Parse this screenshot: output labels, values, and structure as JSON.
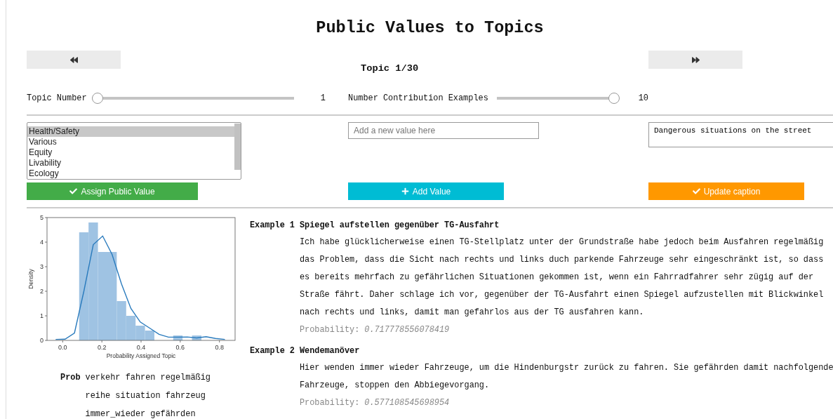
{
  "title": "Public Values to Topics",
  "nav": {
    "topic_label": "Topic 1/30"
  },
  "sliders": [
    {
      "label": "Topic Number",
      "level": 0,
      "reading": "1"
    },
    {
      "label": "Number Contribution Examples",
      "level": 1,
      "reading": "10"
    }
  ],
  "values_list": {
    "items": [
      {
        "label": "Health/Safety",
        "selected": true
      },
      {
        "label": "Various",
        "selected": false
      },
      {
        "label": "Equity",
        "selected": false
      },
      {
        "label": "Livability",
        "selected": false
      },
      {
        "label": "Ecology",
        "selected": false
      }
    ]
  },
  "new_value": {
    "placeholder": "Add a new value here"
  },
  "caption": {
    "value": "Dangerous situations on the street"
  },
  "buttons": [
    {
      "kind": "assign",
      "label": "Assign Public Value",
      "color": "#43ac48"
    },
    {
      "kind": "add",
      "label": "Add Value",
      "color": "#00bcd4"
    },
    {
      "kind": "update",
      "label": "Update caption",
      "color": "#ff9800"
    }
  ],
  "chart": {
    "chart_data": {
      "type": "bar",
      "xlabel": "Probability Assigned Topic",
      "ylabel": "Density",
      "x": [
        -0.036,
        0.012,
        0.06,
        0.108,
        0.156,
        0.204,
        0.252,
        0.3,
        0.348,
        0.396,
        0.444,
        0.492,
        0.54,
        0.588,
        0.636,
        0.684,
        0.732,
        0.78,
        0.828
      ],
      "series": [
        {
          "type": "bar",
          "color": "#9fc3e3",
          "values": [
            null,
            null,
            null,
            4.4,
            4.8,
            3.6,
            3.6,
            1.6,
            1.0,
            0.6,
            0.4,
            null,
            null,
            0.2,
            null,
            0.2,
            null,
            null,
            null
          ]
        },
        {
          "type": "line",
          "color": "#2a7bbd",
          "values": [
            0.04,
            0.05,
            0.3,
            2.0,
            3.9,
            4.25,
            3.5,
            2.3,
            1.3,
            0.75,
            0.5,
            0.25,
            0.13,
            0.13,
            0.14,
            0.1,
            0.15,
            0.08,
            0.04
          ]
        }
      ],
      "xlim": [
        -0.08,
        0.88
      ],
      "ylim": [
        0,
        5
      ],
      "xticks": [
        {
          "value": 0,
          "label": "0.0"
        },
        {
          "value": 0.2,
          "label": "0.2"
        },
        {
          "value": 0.4,
          "label": "0.4"
        },
        {
          "value": 0.6,
          "label": "0.6"
        },
        {
          "value": 0.8,
          "label": "0.8"
        }
      ],
      "yticks": [
        0,
        1,
        2,
        3,
        4,
        5
      ]
    }
  },
  "prob_words": {
    "label": "Prob",
    "lines": [
      "verkehr fahren regelmäßig",
      "reihe situation fahrzeug",
      "immer_wieder gefährden"
    ]
  },
  "examples": [
    {
      "label": "Example 1",
      "title": "Spiegel aufstellen gegenüber TG-Ausfahrt",
      "text": "Ich habe glücklicherweise einen TG-Stellplatz unter der Grundstraße habe jedoch beim Ausfahren regelmäßig das Problem, dass die Sicht nach rechts und links duch parkende Fahrzeuge sehr eingeschränkt ist, so dass es bereits mehrfach zu gefährlichen Situationen gekommen ist, wenn ein Fahrradfahrer sehr zügig auf der Straße fährt. Daher schlage ich vor, gegenüber der TG-Ausfahrt einen Spiegel aufzustellen mit Blickwinkel nach rechts und links, damit man gefahrlos aus der TG ausfahren kann.",
      "prob_label": "Probability:",
      "prob_value": "0.717778556078419"
    },
    {
      "label": "Example 2",
      "title": "Wendemanöver",
      "text": "Hier wenden immer wieder Fahrzeuge, um die Hindenburgstr zurück zu fahren. Sie gefährden damit nachfolgende Fahrzeuge, stoppen den Abbiegevorgang.",
      "prob_label": "Probability:",
      "prob_value": "0.577108545698954"
    }
  ]
}
